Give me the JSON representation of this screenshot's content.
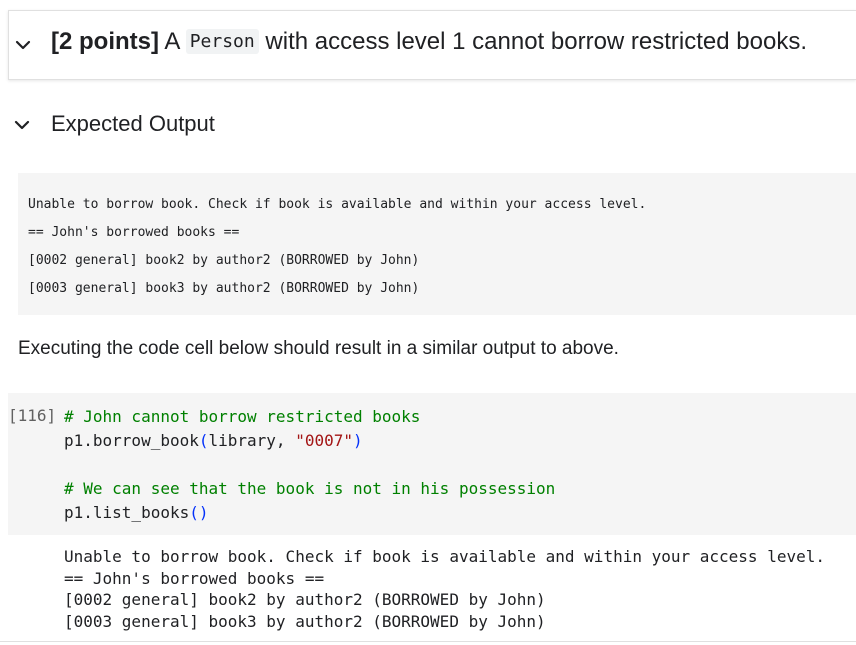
{
  "section": {
    "points": "[2 points]",
    "title_pre": " A ",
    "title_code": "Person",
    "title_post": " with access level 1 cannot borrow restricted books."
  },
  "expected": {
    "heading": "Expected Output",
    "lines": [
      "Unable to borrow book. Check if book is available and within your access level.",
      "== John's borrowed books ==",
      "[0002 general] book2 by author2 (BORROWED by John)",
      "[0003 general] book3 by author2 (BORROWED by John)"
    ]
  },
  "instruction": "Executing the code cell below should result in a similar output to above.",
  "cell": {
    "exec_count": "[116]",
    "comment1": "# John cannot borrow restricted books",
    "call1_obj": "p1.borrow_book",
    "call1_open": "(",
    "call1_arg1": "library, ",
    "call1_arg2": "\"0007\"",
    "call1_close": ")",
    "comment2": "# We can see that the book is not in his possession",
    "call2_obj": "p1.list_books",
    "call2_parens": "()"
  },
  "output": {
    "lines": [
      "Unable to borrow book. Check if book is available and within your access level.",
      "== John's borrowed books ==",
      "[0002 general] book2 by author2 (BORROWED by John)",
      "[0003 general] book3 by author2 (BORROWED by John)"
    ]
  },
  "icons": {
    "collapse": "chevron-down-icon"
  }
}
